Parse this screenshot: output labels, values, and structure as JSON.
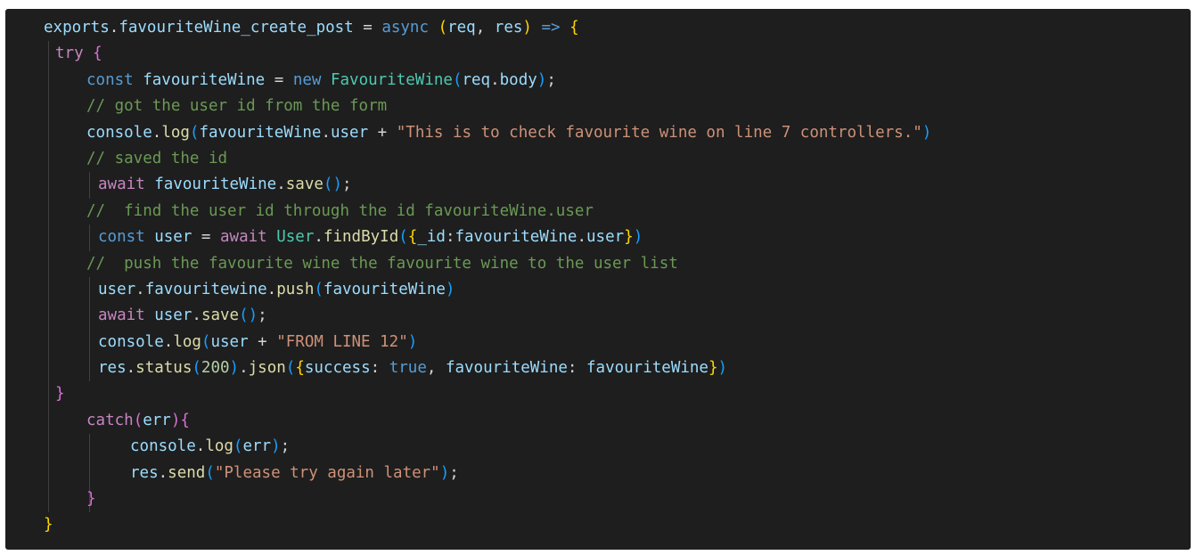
{
  "editor": {
    "lines": [
      {
        "tokens": [
          {
            "t": "exports",
            "c": "var"
          },
          {
            "t": ".",
            "c": "plain"
          },
          {
            "t": "favouriteWine_create_post",
            "c": "var"
          },
          {
            "t": " = ",
            "c": "plain"
          },
          {
            "t": "async",
            "c": "kw-blue"
          },
          {
            "t": " ",
            "c": "plain"
          },
          {
            "t": "(",
            "c": "br-gold"
          },
          {
            "t": "req",
            "c": "var"
          },
          {
            "t": ", ",
            "c": "plain"
          },
          {
            "t": "res",
            "c": "var"
          },
          {
            "t": ")",
            "c": "br-gold"
          },
          {
            "t": " ",
            "c": "plain"
          },
          {
            "t": "=>",
            "c": "kw-blue"
          },
          {
            "t": " ",
            "c": "plain"
          },
          {
            "t": "{",
            "c": "br-gold"
          }
        ]
      },
      {
        "tokens": [
          {
            "t": "try",
            "c": "kw-pink"
          },
          {
            "t": " ",
            "c": "plain"
          },
          {
            "t": "{",
            "c": "br-pink"
          }
        ]
      },
      {
        "tokens": [
          {
            "t": "const",
            "c": "kw-blue"
          },
          {
            "t": " ",
            "c": "plain"
          },
          {
            "t": "favouriteWine",
            "c": "var"
          },
          {
            "t": " = ",
            "c": "plain"
          },
          {
            "t": "new",
            "c": "kw-blue"
          },
          {
            "t": " ",
            "c": "plain"
          },
          {
            "t": "FavouriteWine",
            "c": "cls"
          },
          {
            "t": "(",
            "c": "br-blue"
          },
          {
            "t": "req",
            "c": "var"
          },
          {
            "t": ".",
            "c": "plain"
          },
          {
            "t": "body",
            "c": "var"
          },
          {
            "t": ")",
            "c": "br-blue"
          },
          {
            "t": ";",
            "c": "plain"
          }
        ]
      },
      {
        "tokens": [
          {
            "t": "// got the user id from the form",
            "c": "cmt"
          }
        ]
      },
      {
        "tokens": [
          {
            "t": "console",
            "c": "var"
          },
          {
            "t": ".",
            "c": "plain"
          },
          {
            "t": "log",
            "c": "fn"
          },
          {
            "t": "(",
            "c": "br-blue"
          },
          {
            "t": "favouriteWine",
            "c": "var"
          },
          {
            "t": ".",
            "c": "plain"
          },
          {
            "t": "user",
            "c": "var"
          },
          {
            "t": " + ",
            "c": "plain"
          },
          {
            "t": "\"This is to check favourite wine on line 7 controllers.\"",
            "c": "str"
          },
          {
            "t": ")",
            "c": "br-blue"
          }
        ]
      },
      {
        "tokens": [
          {
            "t": "// saved the id",
            "c": "cmt"
          }
        ]
      },
      {
        "tokens": [
          {
            "t": "await",
            "c": "kw-pink"
          },
          {
            "t": " ",
            "c": "plain"
          },
          {
            "t": "favouriteWine",
            "c": "var"
          },
          {
            "t": ".",
            "c": "plain"
          },
          {
            "t": "save",
            "c": "fn"
          },
          {
            "t": "()",
            "c": "br-blue"
          },
          {
            "t": ";",
            "c": "plain"
          }
        ]
      },
      {
        "tokens": [
          {
            "t": "//  find the user id through the id favouriteWine.user",
            "c": "cmt"
          }
        ]
      },
      {
        "tokens": [
          {
            "t": "const",
            "c": "kw-blue"
          },
          {
            "t": " ",
            "c": "plain"
          },
          {
            "t": "user",
            "c": "var"
          },
          {
            "t": " = ",
            "c": "plain"
          },
          {
            "t": "await",
            "c": "kw-pink"
          },
          {
            "t": " ",
            "c": "plain"
          },
          {
            "t": "User",
            "c": "cls"
          },
          {
            "t": ".",
            "c": "plain"
          },
          {
            "t": "findById",
            "c": "fn"
          },
          {
            "t": "(",
            "c": "br-blue"
          },
          {
            "t": "{",
            "c": "br-gold"
          },
          {
            "t": "_id",
            "c": "var"
          },
          {
            "t": ":",
            "c": "plain"
          },
          {
            "t": "favouriteWine",
            "c": "var"
          },
          {
            "t": ".",
            "c": "plain"
          },
          {
            "t": "user",
            "c": "var"
          },
          {
            "t": "}",
            "c": "br-gold"
          },
          {
            "t": ")",
            "c": "br-blue"
          }
        ]
      },
      {
        "tokens": [
          {
            "t": "//  push the favourite wine the favourite wine to the user list",
            "c": "cmt"
          }
        ]
      },
      {
        "tokens": [
          {
            "t": "user",
            "c": "var"
          },
          {
            "t": ".",
            "c": "plain"
          },
          {
            "t": "favouritewine",
            "c": "var"
          },
          {
            "t": ".",
            "c": "plain"
          },
          {
            "t": "push",
            "c": "fn"
          },
          {
            "t": "(",
            "c": "br-blue"
          },
          {
            "t": "favouriteWine",
            "c": "var"
          },
          {
            "t": ")",
            "c": "br-blue"
          }
        ]
      },
      {
        "tokens": [
          {
            "t": "await",
            "c": "kw-pink"
          },
          {
            "t": " ",
            "c": "plain"
          },
          {
            "t": "user",
            "c": "var"
          },
          {
            "t": ".",
            "c": "plain"
          },
          {
            "t": "save",
            "c": "fn"
          },
          {
            "t": "()",
            "c": "br-blue"
          },
          {
            "t": ";",
            "c": "plain"
          }
        ]
      },
      {
        "tokens": [
          {
            "t": "console",
            "c": "var"
          },
          {
            "t": ".",
            "c": "plain"
          },
          {
            "t": "log",
            "c": "fn"
          },
          {
            "t": "(",
            "c": "br-blue"
          },
          {
            "t": "user",
            "c": "var"
          },
          {
            "t": " + ",
            "c": "plain"
          },
          {
            "t": "\"FROM LINE 12\"",
            "c": "str"
          },
          {
            "t": ")",
            "c": "br-blue"
          }
        ]
      },
      {
        "tokens": [
          {
            "t": "res",
            "c": "var"
          },
          {
            "t": ".",
            "c": "plain"
          },
          {
            "t": "status",
            "c": "fn"
          },
          {
            "t": "(",
            "c": "br-blue"
          },
          {
            "t": "200",
            "c": "num"
          },
          {
            "t": ")",
            "c": "br-blue"
          },
          {
            "t": ".",
            "c": "plain"
          },
          {
            "t": "json",
            "c": "fn"
          },
          {
            "t": "(",
            "c": "br-blue"
          },
          {
            "t": "{",
            "c": "br-gold"
          },
          {
            "t": "success",
            "c": "var"
          },
          {
            "t": ": ",
            "c": "plain"
          },
          {
            "t": "true",
            "c": "kw-blue"
          },
          {
            "t": ", ",
            "c": "plain"
          },
          {
            "t": "favouriteWine",
            "c": "var"
          },
          {
            "t": ": ",
            "c": "plain"
          },
          {
            "t": "favouriteWine",
            "c": "var"
          },
          {
            "t": "}",
            "c": "br-gold"
          },
          {
            "t": ")",
            "c": "br-blue"
          }
        ]
      },
      {
        "tokens": [
          {
            "t": "}",
            "c": "br-pink"
          }
        ]
      },
      {
        "tokens": [
          {
            "t": "catch",
            "c": "kw-pink"
          },
          {
            "t": "(",
            "c": "br-pink"
          },
          {
            "t": "err",
            "c": "var"
          },
          {
            "t": ")",
            "c": "br-pink"
          },
          {
            "t": "{",
            "c": "br-pink"
          }
        ]
      },
      {
        "tokens": [
          {
            "t": "console",
            "c": "var"
          },
          {
            "t": ".",
            "c": "plain"
          },
          {
            "t": "log",
            "c": "fn"
          },
          {
            "t": "(",
            "c": "br-blue"
          },
          {
            "t": "err",
            "c": "var"
          },
          {
            "t": ")",
            "c": "br-blue"
          },
          {
            "t": ";",
            "c": "plain"
          }
        ]
      },
      {
        "tokens": [
          {
            "t": "res",
            "c": "var"
          },
          {
            "t": ".",
            "c": "plain"
          },
          {
            "t": "send",
            "c": "fn"
          },
          {
            "t": "(",
            "c": "br-blue"
          },
          {
            "t": "\"Please try again later\"",
            "c": "str"
          },
          {
            "t": ")",
            "c": "br-blue"
          },
          {
            "t": ";",
            "c": "plain"
          }
        ]
      },
      {
        "tokens": [
          {
            "t": "}",
            "c": "br-pink"
          }
        ]
      },
      {
        "tokens": [
          {
            "t": "}",
            "c": "br-gold"
          }
        ]
      }
    ]
  }
}
